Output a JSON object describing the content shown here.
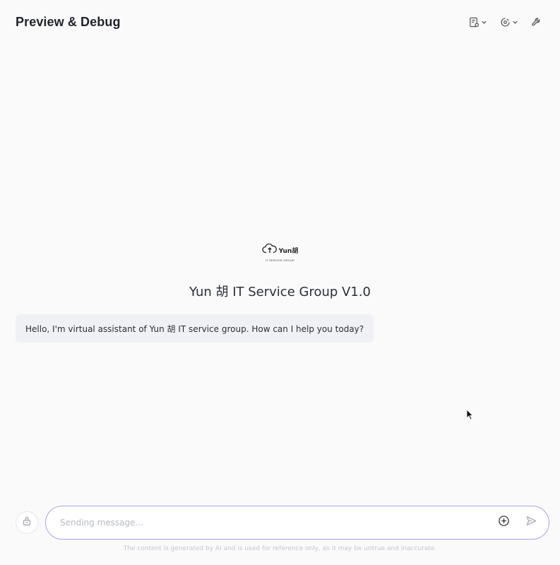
{
  "header": {
    "title": "Preview & Debug",
    "actions": [
      {
        "icon": "document-settings-icon",
        "has_dropdown": true
      },
      {
        "icon": "plugin-icon",
        "has_dropdown": true
      },
      {
        "icon": "wrench-icon",
        "has_dropdown": false
      }
    ]
  },
  "bot": {
    "logo_text": "Yun胡",
    "logo_subtext": "IT SERVICE GROUP",
    "name": "Yun 胡 IT Service Group V1.0"
  },
  "messages": [
    {
      "role": "assistant",
      "text": "Hello, I'm virtual assistant of Yun 胡 IT service group. How can I help you today?"
    }
  ],
  "composer": {
    "placeholder": "Sending message...",
    "value": "",
    "left_icon": "clear-history-icon",
    "add_icon": "add-circle-icon",
    "send_icon": "send-icon"
  },
  "footer": {
    "disclaimer": "The content is generated by AI and is used for reference only, as it may be untrue and inaccurate."
  },
  "colors": {
    "background": "#fafafb",
    "input_border": "#a8a4e6",
    "message_bubble": "#f0f1f4"
  }
}
